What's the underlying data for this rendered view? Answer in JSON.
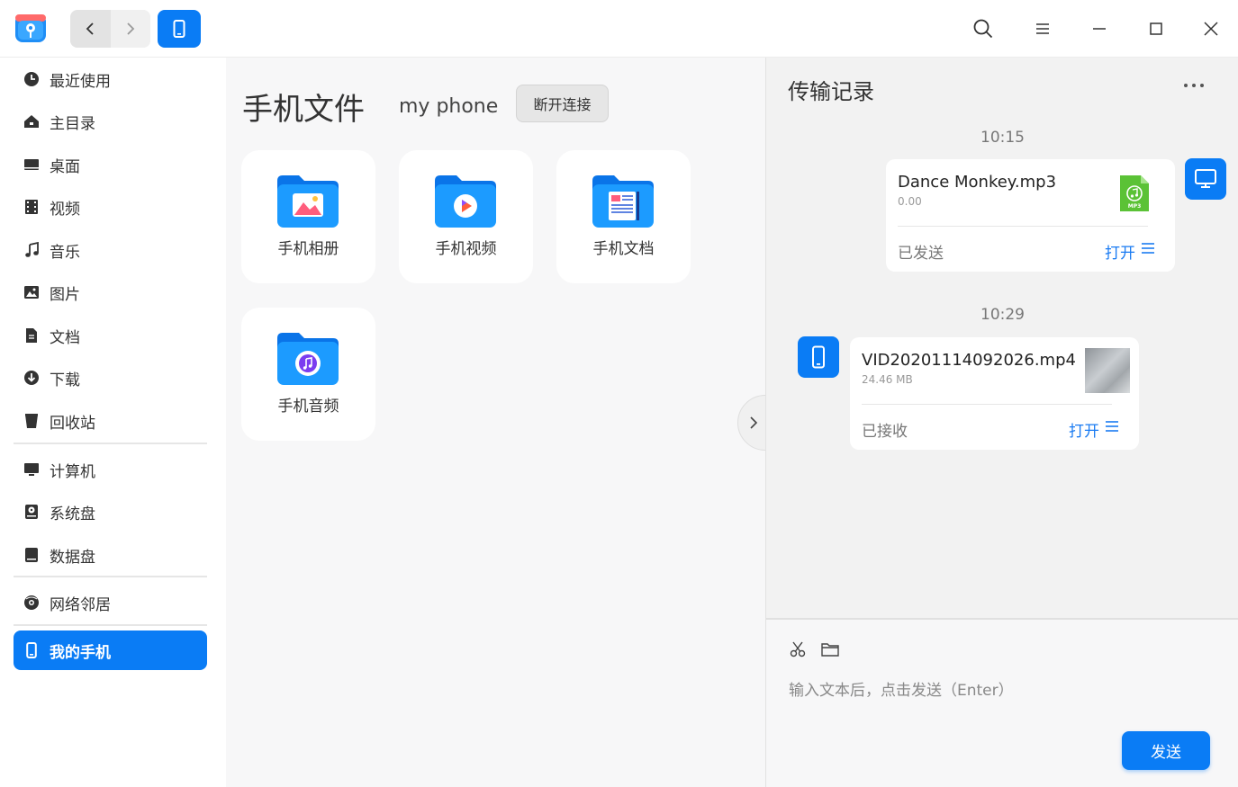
{
  "colors": {
    "accent": "#0a7cf5",
    "link": "#1a7bf2",
    "mp3_green": "#5bc236"
  },
  "titlebar": {
    "icons": [
      "back-icon",
      "forward-icon",
      "phone-icon",
      "search-icon",
      "menu-icon",
      "minimize-icon",
      "maximize-icon",
      "close-icon"
    ]
  },
  "sidebar": {
    "items": [
      {
        "label": "最近使用",
        "icon": "recent-icon"
      },
      {
        "label": "主目录",
        "icon": "home-icon"
      },
      {
        "label": "桌面",
        "icon": "desktop-icon"
      },
      {
        "label": "视频",
        "icon": "video-icon"
      },
      {
        "label": "音乐",
        "icon": "music-icon"
      },
      {
        "label": "图片",
        "icon": "picture-icon"
      },
      {
        "label": "文档",
        "icon": "document-icon"
      },
      {
        "label": "下载",
        "icon": "download-icon"
      },
      {
        "label": "回收站",
        "icon": "trash-icon"
      },
      {
        "label": "计算机",
        "icon": "computer-icon"
      },
      {
        "label": "系统盘",
        "icon": "system-disk-icon"
      },
      {
        "label": "数据盘",
        "icon": "data-disk-icon"
      },
      {
        "label": "网络邻居",
        "icon": "network-icon"
      },
      {
        "label": "我的手机",
        "icon": "phone-icon",
        "active": true
      }
    ]
  },
  "main": {
    "title": "手机文件",
    "device_name": "my phone",
    "disconnect_label": "断开连接",
    "folders": [
      {
        "label": "手机相册",
        "icon": "photo-folder-icon"
      },
      {
        "label": "手机视频",
        "icon": "video-folder-icon"
      },
      {
        "label": "手机文档",
        "icon": "document-folder-icon"
      },
      {
        "label": "手机音频",
        "icon": "audio-folder-icon"
      }
    ]
  },
  "panel": {
    "title": "传输记录",
    "transfers": [
      {
        "time": "10:15",
        "file_name": "Dance Monkey.mp3",
        "file_size": "0.00",
        "status": "已发送",
        "open_label": "打开",
        "direction": "sent",
        "thumb": "mp3-file-icon",
        "thumb_text": "MP3"
      },
      {
        "time": "10:29",
        "file_name": "VID20201114092026.mp4",
        "file_size": "24.46 MB",
        "status": "已接收",
        "open_label": "打开",
        "direction": "received",
        "thumb": "video-thumbnail"
      }
    ],
    "input_placeholder": "输入文本后，点击发送（Enter）",
    "send_label": "发送"
  }
}
